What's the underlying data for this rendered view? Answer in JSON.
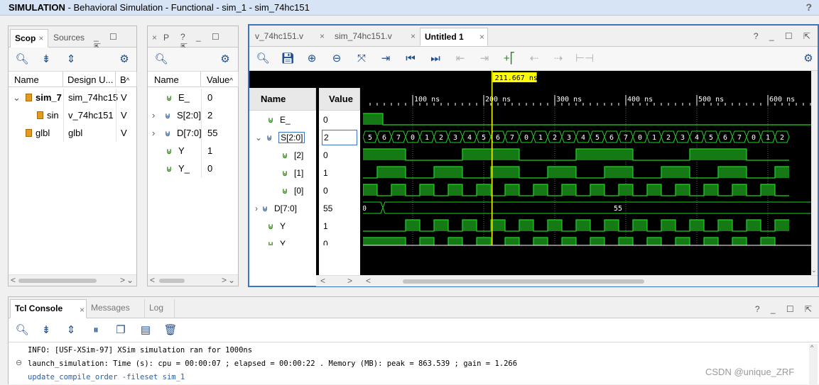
{
  "title": {
    "mode": "SIMULATION",
    "rest": " - Behavioral Simulation - Functional - sim_1 - sim_74hc151",
    "help": "?"
  },
  "scope_panel": {
    "tabs": [
      "Scop",
      "Sources"
    ],
    "columns": [
      "Name",
      "Design U...",
      "B"
    ],
    "rows": [
      {
        "name": "sim_7",
        "design": "sim_74hc15",
        "b": "V"
      },
      {
        "name": "sin",
        "design": "v_74hc151",
        "b": "V"
      },
      {
        "name": "glbl",
        "design": "glbl",
        "b": "V"
      }
    ]
  },
  "objects_panel": {
    "tab": "P",
    "columns": [
      "Name",
      "Value"
    ],
    "rows": [
      {
        "name": "E_",
        "value": "0"
      },
      {
        "name": "S[2:0]",
        "value": "2"
      },
      {
        "name": "D[7:0]",
        "value": "55"
      },
      {
        "name": "Y",
        "value": "1"
      },
      {
        "name": "Y_",
        "value": "0"
      }
    ]
  },
  "wave_panel": {
    "tabs": [
      "v_74hc151.v",
      "sim_74hc151.v",
      "Untitled 1"
    ],
    "cursor_label": "211.667 ns",
    "name_header": "Name",
    "value_header": "Value",
    "signals": [
      {
        "name": "E_",
        "value": "0"
      },
      {
        "name": "S[2:0]",
        "value": "2"
      },
      {
        "name": "[2]",
        "value": "0"
      },
      {
        "name": "[1]",
        "value": "1"
      },
      {
        "name": "[0]",
        "value": "0"
      },
      {
        "name": "D[7:0]",
        "value": "55"
      },
      {
        "name": "Y",
        "value": "1"
      },
      {
        "name": "Y_",
        "value": "0"
      }
    ],
    "time_ticks": [
      "100 ns",
      "200 ns",
      "300 ns",
      "400 ns",
      "500 ns",
      "600 ns"
    ],
    "s_bus_values": [
      "4",
      "5",
      "6",
      "7",
      "0",
      "1",
      "2",
      "3",
      "4",
      "5",
      "6",
      "7",
      "0",
      "1",
      "2",
      "3",
      "4",
      "5",
      "6",
      "7",
      "0",
      "1",
      "2",
      "3",
      "4",
      "5",
      "6",
      "7",
      "0",
      "1",
      "2"
    ],
    "d_bus_values": [
      "00",
      "55"
    ],
    "colors": {
      "wave": "#22d322",
      "high_fill": "#157a15",
      "cursor": "#ffff00",
      "marker_bg": "#ffff00"
    }
  },
  "console_panel": {
    "tabs": [
      "Tcl Console",
      "Messages",
      "Log"
    ],
    "lines": [
      "INFO: [USF-XSim-97] XSim simulation ran for 1000ns",
      "launch_simulation: Time (s): cpu = 00:00:07 ; elapsed = 00:00:22 . Memory (MB): peak = 863.539 ; gain = 1.266",
      "update_compile_order -fileset sim_1"
    ]
  },
  "watermark": "CSDN @unique_ZRF"
}
